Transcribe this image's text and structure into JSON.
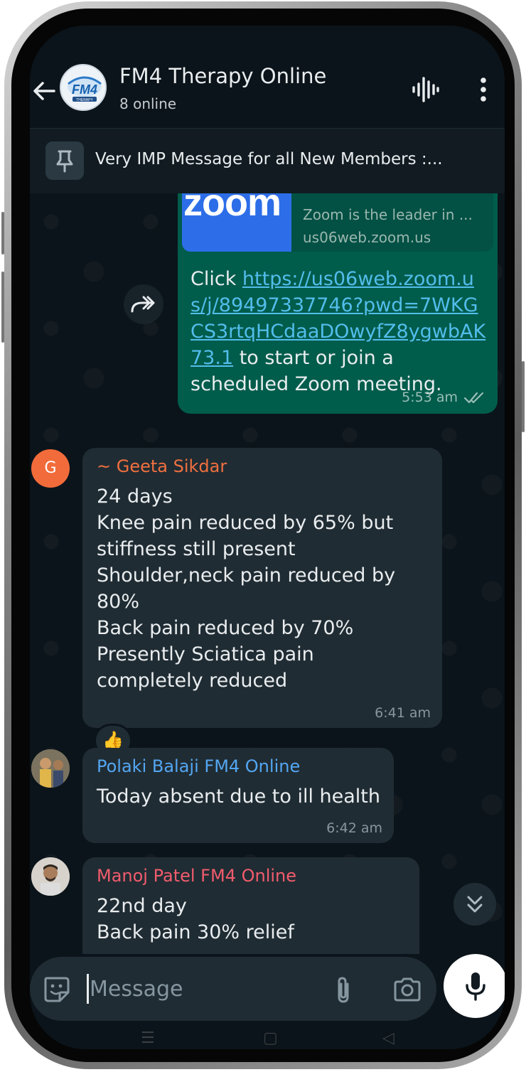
{
  "header": {
    "title": "FM4 Therapy Online",
    "subtitle": "8 online",
    "avatar_text": "FM4",
    "avatar_subtext": "THERAPY"
  },
  "pinned": {
    "text": "Very IMP Message for all New Members :..."
  },
  "messages": [
    {
      "direction": "out",
      "link_preview": {
        "thumbnail_text": "zoom",
        "description": "Zoom is the leader in ...",
        "domain": "us06web.zoom.us"
      },
      "text_prefix": "Click ",
      "link": "https://us06web.zoom.us/j/89497337746?pwd=7WKGCS3rtqHCdaaDOwyfZ8ygwbAK73.1",
      "text_suffix": " to start or join a scheduled Zoom meeting.",
      "time": "5:53 am",
      "status": "read"
    },
    {
      "direction": "in",
      "avatar_letter": "G",
      "sender": "~ Geeta  Sikdar",
      "sender_color": "#f0703f",
      "lines": [
        "24 days",
        "Knee pain reduced by 65% but",
        "stiffness still present",
        "Shoulder,neck pain reduced by",
        "80%",
        "Back pain reduced by 70%",
        "Presently Sciatica pain",
        "completely reduced"
      ],
      "time": "6:41 am",
      "reaction": "👍"
    },
    {
      "direction": "in",
      "sender": "Polaki Balaji FM4 Online",
      "sender_color": "#53a6f2",
      "lines": [
        "Today absent due to ill health"
      ],
      "time": "6:42 am"
    },
    {
      "direction": "in",
      "sender": "Manoj Patel FM4 Online",
      "sender_color": "#f15c6d",
      "lines": [
        "22nd day",
        "Back pain 30% relief"
      ]
    }
  ],
  "composer": {
    "placeholder": "Message"
  },
  "colors": {
    "chat_background": "#0b141a",
    "outgoing_bubble": "#005c4b",
    "incoming_bubble": "#202c33",
    "link": "#53bdeb",
    "read_ticks": "#99beb7"
  },
  "icons": [
    "back-arrow-icon",
    "voice-chat-icon",
    "more-vert-icon",
    "pin-icon",
    "forward-icon",
    "double-check-icon",
    "thumbs-up-icon",
    "double-chevron-down-icon",
    "sticker-icon",
    "paperclip-icon",
    "camera-icon",
    "mic-icon"
  ]
}
